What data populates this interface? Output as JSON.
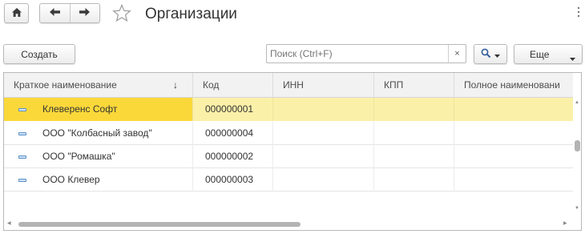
{
  "window": {
    "title": "Организации"
  },
  "toolbar": {
    "create_label": "Создать",
    "more_label": "Еще",
    "search": {
      "placeholder": "Поиск (Ctrl+F)",
      "value": "",
      "clear_glyph": "×"
    }
  },
  "icons": {
    "home": "home-icon",
    "back": "arrow-left-icon",
    "forward": "arrow-right-icon",
    "favorite": "star-icon",
    "more": "vertical-dots-icon",
    "search": "magnifier-icon",
    "row": "catalog-item-icon"
  },
  "colors": {
    "selected_row": "#fbf0a8",
    "selected_cell": "#fbd83a",
    "header_bg": "#f2f2f2",
    "row_icon": "#5a8fc8"
  },
  "table": {
    "sort_indicator": "↓",
    "columns": [
      "Краткое наименование",
      "Код",
      "ИНН",
      "КПП",
      "Полное наименовани"
    ],
    "rows": [
      {
        "name": "Клеверенс Софт",
        "code": "000000001",
        "inn": "",
        "kpp": "",
        "full_name": "",
        "selected": true
      },
      {
        "name": "ООО \"Колбасный завод\"",
        "code": "000000004",
        "inn": "",
        "kpp": "",
        "full_name": "",
        "selected": false
      },
      {
        "name": "ООО \"Ромашка\"",
        "code": "000000002",
        "inn": "",
        "kpp": "",
        "full_name": "",
        "selected": false
      },
      {
        "name": "ООО Клевер",
        "code": "000000003",
        "inn": "",
        "kpp": "",
        "full_name": "",
        "selected": false
      }
    ]
  }
}
